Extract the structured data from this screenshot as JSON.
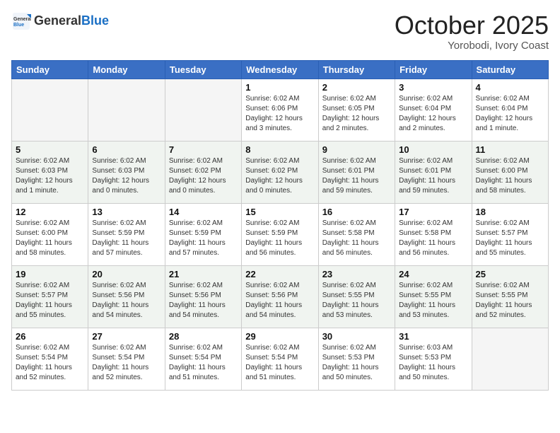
{
  "header": {
    "logo_general": "General",
    "logo_blue": "Blue",
    "month": "October 2025",
    "location": "Yorobodi, Ivory Coast"
  },
  "days_of_week": [
    "Sunday",
    "Monday",
    "Tuesday",
    "Wednesday",
    "Thursday",
    "Friday",
    "Saturday"
  ],
  "weeks": [
    [
      {
        "day": "",
        "info": ""
      },
      {
        "day": "",
        "info": ""
      },
      {
        "day": "",
        "info": ""
      },
      {
        "day": "1",
        "info": "Sunrise: 6:02 AM\nSunset: 6:06 PM\nDaylight: 12 hours\nand 3 minutes."
      },
      {
        "day": "2",
        "info": "Sunrise: 6:02 AM\nSunset: 6:05 PM\nDaylight: 12 hours\nand 2 minutes."
      },
      {
        "day": "3",
        "info": "Sunrise: 6:02 AM\nSunset: 6:04 PM\nDaylight: 12 hours\nand 2 minutes."
      },
      {
        "day": "4",
        "info": "Sunrise: 6:02 AM\nSunset: 6:04 PM\nDaylight: 12 hours\nand 1 minute."
      }
    ],
    [
      {
        "day": "5",
        "info": "Sunrise: 6:02 AM\nSunset: 6:03 PM\nDaylight: 12 hours\nand 1 minute."
      },
      {
        "day": "6",
        "info": "Sunrise: 6:02 AM\nSunset: 6:03 PM\nDaylight: 12 hours\nand 0 minutes."
      },
      {
        "day": "7",
        "info": "Sunrise: 6:02 AM\nSunset: 6:02 PM\nDaylight: 12 hours\nand 0 minutes."
      },
      {
        "day": "8",
        "info": "Sunrise: 6:02 AM\nSunset: 6:02 PM\nDaylight: 12 hours\nand 0 minutes."
      },
      {
        "day": "9",
        "info": "Sunrise: 6:02 AM\nSunset: 6:01 PM\nDaylight: 11 hours\nand 59 minutes."
      },
      {
        "day": "10",
        "info": "Sunrise: 6:02 AM\nSunset: 6:01 PM\nDaylight: 11 hours\nand 59 minutes."
      },
      {
        "day": "11",
        "info": "Sunrise: 6:02 AM\nSunset: 6:00 PM\nDaylight: 11 hours\nand 58 minutes."
      }
    ],
    [
      {
        "day": "12",
        "info": "Sunrise: 6:02 AM\nSunset: 6:00 PM\nDaylight: 11 hours\nand 58 minutes."
      },
      {
        "day": "13",
        "info": "Sunrise: 6:02 AM\nSunset: 5:59 PM\nDaylight: 11 hours\nand 57 minutes."
      },
      {
        "day": "14",
        "info": "Sunrise: 6:02 AM\nSunset: 5:59 PM\nDaylight: 11 hours\nand 57 minutes."
      },
      {
        "day": "15",
        "info": "Sunrise: 6:02 AM\nSunset: 5:59 PM\nDaylight: 11 hours\nand 56 minutes."
      },
      {
        "day": "16",
        "info": "Sunrise: 6:02 AM\nSunset: 5:58 PM\nDaylight: 11 hours\nand 56 minutes."
      },
      {
        "day": "17",
        "info": "Sunrise: 6:02 AM\nSunset: 5:58 PM\nDaylight: 11 hours\nand 56 minutes."
      },
      {
        "day": "18",
        "info": "Sunrise: 6:02 AM\nSunset: 5:57 PM\nDaylight: 11 hours\nand 55 minutes."
      }
    ],
    [
      {
        "day": "19",
        "info": "Sunrise: 6:02 AM\nSunset: 5:57 PM\nDaylight: 11 hours\nand 55 minutes."
      },
      {
        "day": "20",
        "info": "Sunrise: 6:02 AM\nSunset: 5:56 PM\nDaylight: 11 hours\nand 54 minutes."
      },
      {
        "day": "21",
        "info": "Sunrise: 6:02 AM\nSunset: 5:56 PM\nDaylight: 11 hours\nand 54 minutes."
      },
      {
        "day": "22",
        "info": "Sunrise: 6:02 AM\nSunset: 5:56 PM\nDaylight: 11 hours\nand 54 minutes."
      },
      {
        "day": "23",
        "info": "Sunrise: 6:02 AM\nSunset: 5:55 PM\nDaylight: 11 hours\nand 53 minutes."
      },
      {
        "day": "24",
        "info": "Sunrise: 6:02 AM\nSunset: 5:55 PM\nDaylight: 11 hours\nand 53 minutes."
      },
      {
        "day": "25",
        "info": "Sunrise: 6:02 AM\nSunset: 5:55 PM\nDaylight: 11 hours\nand 52 minutes."
      }
    ],
    [
      {
        "day": "26",
        "info": "Sunrise: 6:02 AM\nSunset: 5:54 PM\nDaylight: 11 hours\nand 52 minutes."
      },
      {
        "day": "27",
        "info": "Sunrise: 6:02 AM\nSunset: 5:54 PM\nDaylight: 11 hours\nand 52 minutes."
      },
      {
        "day": "28",
        "info": "Sunrise: 6:02 AM\nSunset: 5:54 PM\nDaylight: 11 hours\nand 51 minutes."
      },
      {
        "day": "29",
        "info": "Sunrise: 6:02 AM\nSunset: 5:54 PM\nDaylight: 11 hours\nand 51 minutes."
      },
      {
        "day": "30",
        "info": "Sunrise: 6:02 AM\nSunset: 5:53 PM\nDaylight: 11 hours\nand 50 minutes."
      },
      {
        "day": "31",
        "info": "Sunrise: 6:03 AM\nSunset: 5:53 PM\nDaylight: 11 hours\nand 50 minutes."
      },
      {
        "day": "",
        "info": ""
      }
    ]
  ]
}
